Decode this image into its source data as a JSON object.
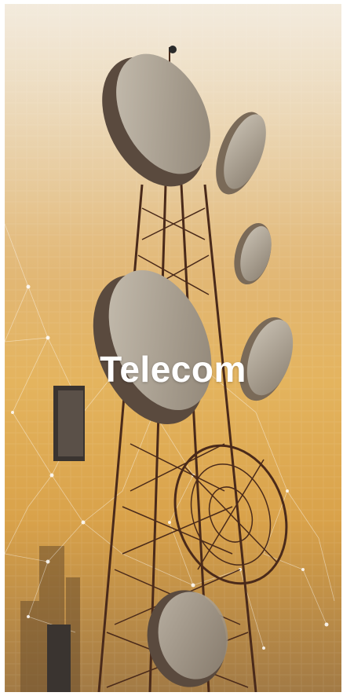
{
  "caption": "Telecom"
}
